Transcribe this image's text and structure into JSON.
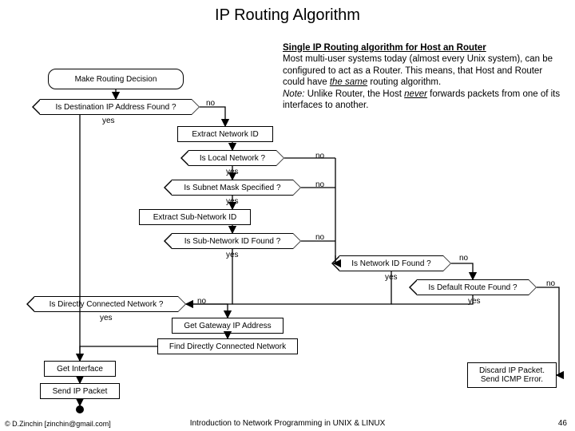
{
  "title": "IP Routing Algorithm",
  "description": {
    "heading": "Single IP Routing algorithm for Host an Router",
    "line1a": "Most multi-user systems today (almost every Unix system), can be configured to act as a Router.  This means, that Host and Router could have ",
    "line1b": "the same",
    "line1c": " routing algorithm.",
    "note_label": "Note:",
    "note_a": "   Unlike Router, the Host ",
    "note_b": "never",
    "note_c": " forwards packets from one of its interfaces to another."
  },
  "nodes": {
    "make_decision": "Make Routing Decision",
    "dest_found": "Is Destination IP Address Found ?",
    "extract_net": "Extract Network ID",
    "is_local": "Is Local Network ?",
    "subnet_spec": "Is Subnet Mask Specified ?",
    "extract_sub": "Extract Sub-Network ID",
    "sub_found": "Is Sub-Network ID Found ?",
    "net_found": "Is Network ID Found ?",
    "default_found": "Is Default Route Found ?",
    "direct_net": "Is Directly Connected Network ?",
    "get_gateway": "Get Gateway IP Address",
    "find_direct": "Find Directly Connected Network",
    "get_iface": "Get Interface",
    "send_pkt": "Send IP Packet",
    "discard": "Discard IP Packet.\nSend ICMP Error."
  },
  "labels": {
    "yes": "yes",
    "no": "no"
  },
  "footer": {
    "copyright": "© D.Zinchin [zinchin@gmail.com]",
    "center": "Introduction to Network Programming in UNIX & LINUX",
    "page": "46"
  },
  "chart_data": {
    "type": "flowchart",
    "title": "IP Routing Algorithm",
    "nodes": [
      {
        "id": "start",
        "kind": "process",
        "label": "Make Routing Decision"
      },
      {
        "id": "d_dest",
        "kind": "decision",
        "label": "Is Destination IP Address Found ?"
      },
      {
        "id": "p_extract_net",
        "kind": "process",
        "label": "Extract Network ID"
      },
      {
        "id": "d_local",
        "kind": "decision",
        "label": "Is Local Network ?"
      },
      {
        "id": "d_subnet",
        "kind": "decision",
        "label": "Is Subnet Mask Specified ?"
      },
      {
        "id": "p_extract_sub",
        "kind": "process",
        "label": "Extract Sub-Network ID"
      },
      {
        "id": "d_subfound",
        "kind": "decision",
        "label": "Is Sub-Network ID Found ?"
      },
      {
        "id": "d_netfound",
        "kind": "decision",
        "label": "Is Network ID Found ?"
      },
      {
        "id": "d_default",
        "kind": "decision",
        "label": "Is Default Route Found ?"
      },
      {
        "id": "d_direct",
        "kind": "decision",
        "label": "Is Directly Connected Network ?"
      },
      {
        "id": "p_gw",
        "kind": "process",
        "label": "Get Gateway IP Address"
      },
      {
        "id": "p_findconn",
        "kind": "process",
        "label": "Find Directly Connected Network"
      },
      {
        "id": "p_iface",
        "kind": "process",
        "label": "Get Interface"
      },
      {
        "id": "p_send",
        "kind": "process",
        "label": "Send IP Packet"
      },
      {
        "id": "p_discard",
        "kind": "process",
        "label": "Discard IP Packet. Send ICMP Error."
      },
      {
        "id": "end",
        "kind": "terminator",
        "label": ""
      }
    ],
    "edges": [
      {
        "from": "start",
        "to": "d_dest"
      },
      {
        "from": "d_dest",
        "to": "p_extract_net",
        "label": "no"
      },
      {
        "from": "d_dest",
        "to": "p_iface",
        "label": "yes"
      },
      {
        "from": "p_extract_net",
        "to": "d_local"
      },
      {
        "from": "d_local",
        "to": "d_netfound",
        "label": "no"
      },
      {
        "from": "d_local",
        "to": "d_subnet",
        "label": "yes"
      },
      {
        "from": "d_subnet",
        "to": "d_netfound",
        "label": "no"
      },
      {
        "from": "d_subnet",
        "to": "p_extract_sub",
        "label": "yes"
      },
      {
        "from": "p_extract_sub",
        "to": "d_subfound"
      },
      {
        "from": "d_subfound",
        "to": "d_netfound",
        "label": "no"
      },
      {
        "from": "d_subfound",
        "to": "d_direct",
        "label": "yes"
      },
      {
        "from": "d_netfound",
        "to": "d_default",
        "label": "no"
      },
      {
        "from": "d_netfound",
        "to": "d_direct",
        "label": "yes"
      },
      {
        "from": "d_default",
        "to": "p_discard",
        "label": "no"
      },
      {
        "from": "d_default",
        "to": "d_direct",
        "label": "yes"
      },
      {
        "from": "d_direct",
        "to": "p_gw",
        "label": "no"
      },
      {
        "from": "d_direct",
        "to": "p_iface",
        "label": "yes"
      },
      {
        "from": "p_gw",
        "to": "p_findconn"
      },
      {
        "from": "p_findconn",
        "to": "p_iface"
      },
      {
        "from": "p_iface",
        "to": "p_send"
      },
      {
        "from": "p_send",
        "to": "end"
      }
    ]
  }
}
